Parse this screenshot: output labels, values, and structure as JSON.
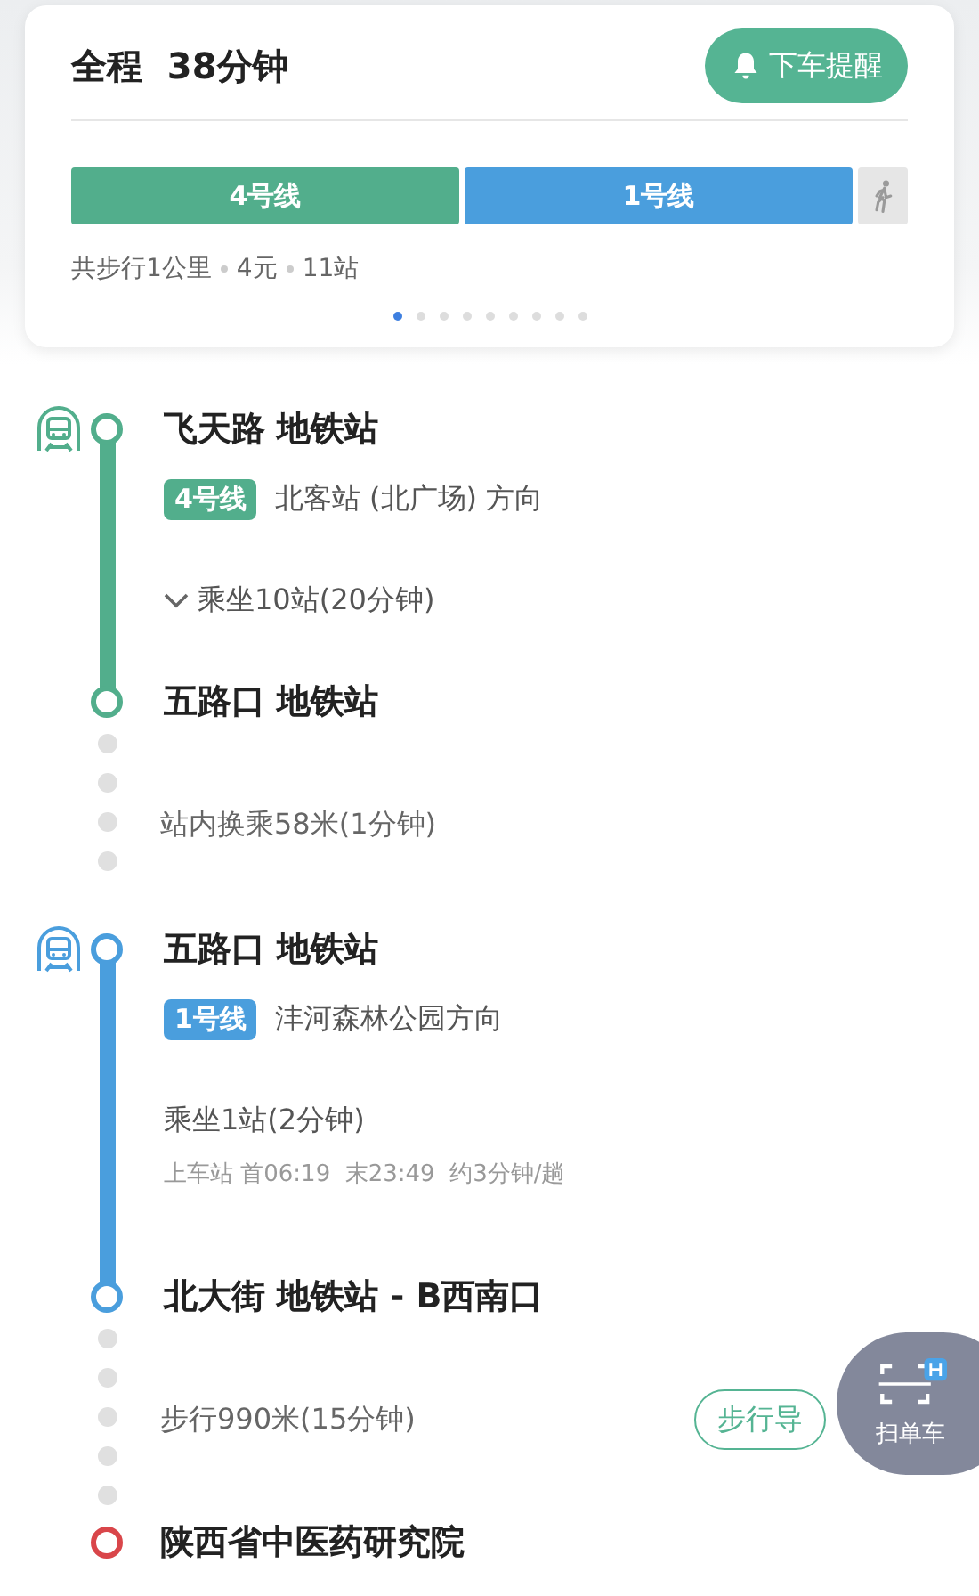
{
  "summary": {
    "label": "全程",
    "duration": "38分钟",
    "remind_button": "下车提醒",
    "route_bar": [
      {
        "kind": "line",
        "label": "4号线",
        "color": "#52ae8c"
      },
      {
        "kind": "line",
        "label": "1号线",
        "color": "#4a9edd"
      },
      {
        "kind": "walk"
      }
    ],
    "stats": [
      "共步行1公里",
      "4元",
      "11站"
    ],
    "pages": [
      {
        "selected": true
      },
      {
        "selected": false
      },
      {
        "selected": false
      },
      {
        "selected": false
      },
      {
        "selected": false
      },
      {
        "selected": false
      },
      {
        "selected": false
      },
      {
        "selected": false
      },
      {
        "selected": false
      }
    ]
  },
  "steps": [
    {
      "kind": "ride",
      "color": "#52ae8c",
      "from": "飞天路 地铁站",
      "line": "4号线",
      "direction": "北客站 (北广场) 方向",
      "ride": "乘坐10站(20分钟)",
      "expandable": true,
      "to": "五路口 地铁站"
    },
    {
      "kind": "transfer",
      "text": "站内换乘58米(1分钟)"
    },
    {
      "kind": "ride",
      "color": "#4a9edd",
      "from": "五路口 地铁站",
      "line": "1号线",
      "direction": "沣河森林公园方向",
      "ride": "乘坐1站(2分钟)",
      "expandable": false,
      "schedule": "上车站 首06:19  末23:49  约3分钟/趟",
      "to": "北大街 地铁站 - B西南口"
    },
    {
      "kind": "walk",
      "text": "步行990米(15分钟)",
      "button": "步行导"
    },
    {
      "kind": "destination",
      "name": "陕西省中医药研究院"
    }
  ],
  "floating_button": {
    "label": "扫单车"
  }
}
